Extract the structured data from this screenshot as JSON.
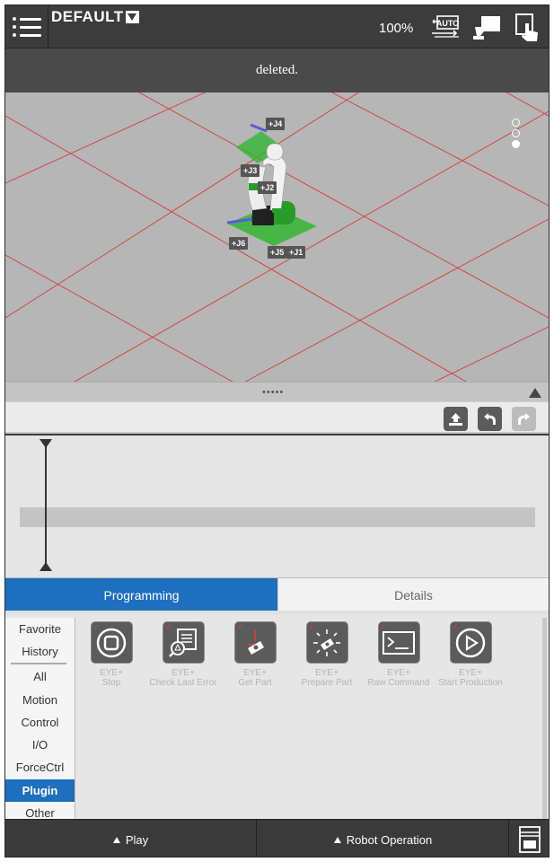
{
  "topbar": {
    "project_name": "DEFAULT",
    "speed": "100%",
    "menu_icon": "menu-icon",
    "auto_icon": "auto-mode-icon",
    "auto_text": "AUTO",
    "remote_icon": "remote-control-icon",
    "hand_icon": "hand-guide-icon"
  },
  "status": {
    "message": "deleted."
  },
  "viewport": {
    "joints": [
      "+J4",
      "+J3",
      "+J2",
      "+J6",
      "+J5",
      "+J1"
    ],
    "floor_color": "#b6b6b6",
    "grid_color": "#d83a3a"
  },
  "divider": {
    "handle": "•••••"
  },
  "toolbar": {
    "icons": [
      "upload-icon",
      "undo-icon",
      "redo-icon"
    ]
  },
  "tabs": {
    "programming": "Programming",
    "details": "Details"
  },
  "categories": [
    "Favorite",
    "History",
    "All",
    "Motion",
    "Control",
    "I/O",
    "ForceCtrl",
    "Plugin",
    "Other"
  ],
  "commands": [
    {
      "line1": "EYE+",
      "line2": "Stop",
      "icon": "stop-icon"
    },
    {
      "line1": "EYE+",
      "line2": "Check Last Error",
      "icon": "check-error-icon"
    },
    {
      "line1": "EYE+",
      "line2": "Get Part",
      "icon": "get-part-icon"
    },
    {
      "line1": "EYE+",
      "line2": "Prepare Part",
      "icon": "prepare-part-icon"
    },
    {
      "line1": "EYE+",
      "line2": "Raw Command",
      "icon": "terminal-icon"
    },
    {
      "line1": "EYE+",
      "line2": "Start Production",
      "icon": "play-circle-icon"
    }
  ],
  "bottombar": {
    "play": "Play",
    "robot_operation": "Robot Operation",
    "panel_icon": "control-panel-icon"
  },
  "colors": {
    "accent": "#1e6fbd",
    "dark_bar": "#3c3c3c"
  }
}
